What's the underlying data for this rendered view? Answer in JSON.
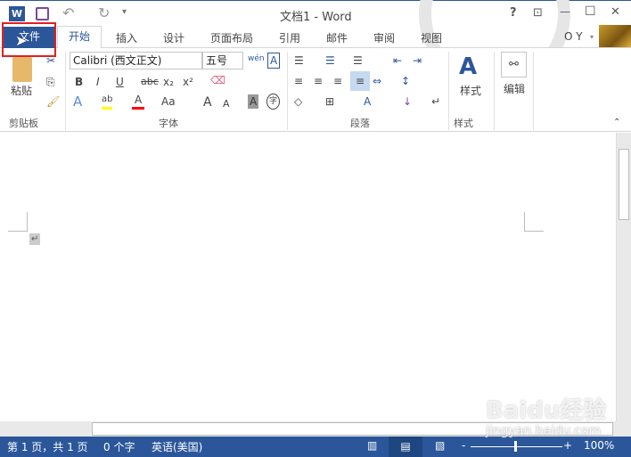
{
  "title": {
    "text": "文档1 - Word",
    "help": "?",
    "restore_ribbon": "⊡",
    "minimize": "—",
    "maximize": "☐",
    "close": "✕",
    "undo": "↶",
    "redo": "↻",
    "customize": "▾"
  },
  "tabs": [
    "文件",
    "开始",
    "插入",
    "设计",
    "页面布局",
    "引用",
    "邮件",
    "审阅",
    "视图"
  ],
  "user": {
    "name": "O Y",
    "chevron": "▾"
  },
  "clipboard": {
    "paste": "粘贴",
    "label": "剪贴板"
  },
  "font": {
    "name": "Calibri (西文正文)",
    "size": "五号",
    "label": "字体",
    "bold": "B",
    "italic": "I",
    "underline": "U",
    "strike": "abc",
    "sub": "x₂",
    "sup": "x²",
    "phonetic": "wén",
    "border_char": "A",
    "text_effect": "A",
    "highlight": "ab",
    "font_color": "A",
    "case": "Aa",
    "grow": "A",
    "shrink": "A",
    "shading": "A",
    "enclose": "字"
  },
  "paragraph": {
    "label": "段落"
  },
  "styles": {
    "button": "样式",
    "label": "样式"
  },
  "editing": {
    "button": "编辑"
  },
  "document": {
    "paragraph_mark": "↵"
  },
  "status": {
    "page": "第 1 页，共 1 页",
    "words": "0 个字",
    "language": "英语(美国)",
    "zoom": "100%",
    "zoom_minus": "-",
    "zoom_plus": "+",
    "zoom_level": 100
  },
  "watermark": {
    "text": "Baidu经验",
    "url": "jingyan.baidu.com"
  },
  "colors": {
    "accent": "#2b579a",
    "highlight": "#ffff00",
    "font_color": "#ff0000",
    "file_outline": "#e02020"
  }
}
